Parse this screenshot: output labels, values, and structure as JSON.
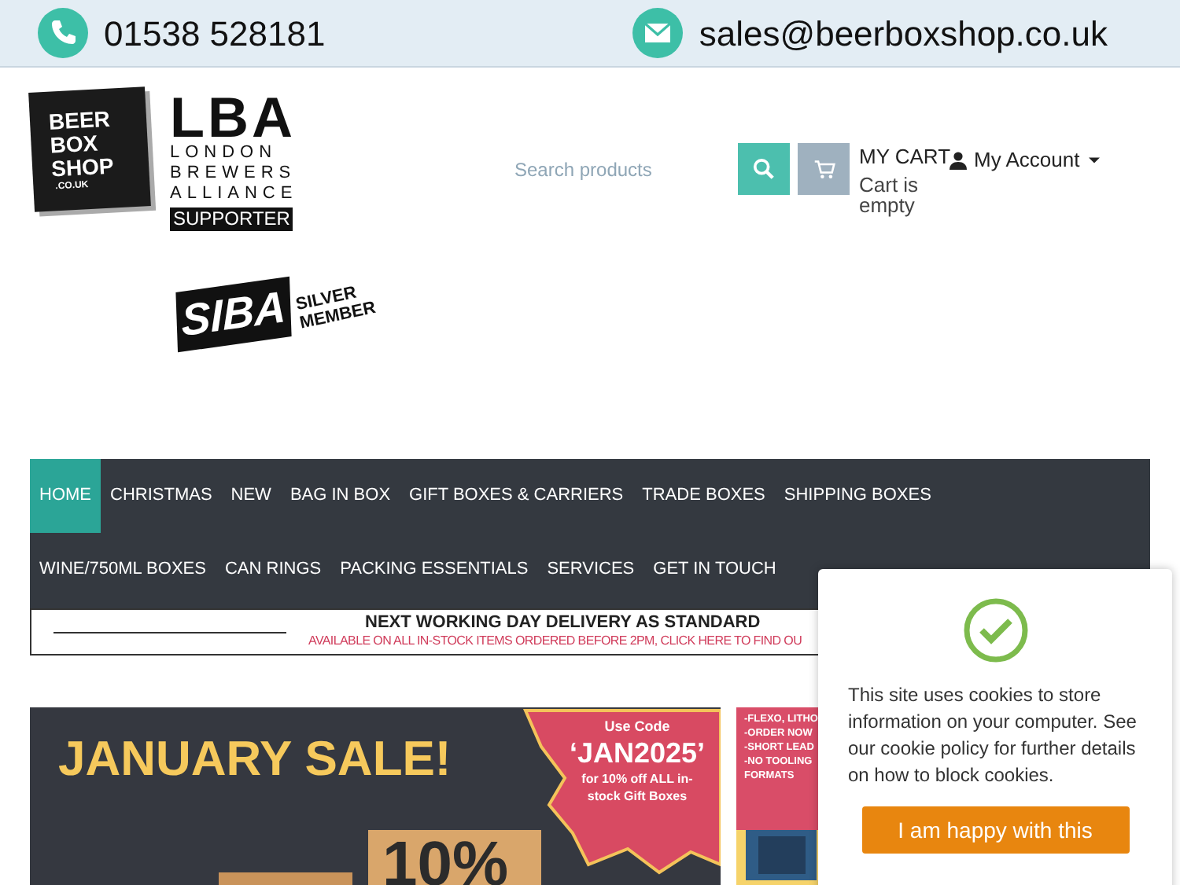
{
  "top_bar": {
    "phone": "01538 528181",
    "email": "sales@beerboxshop.co.uk"
  },
  "logos": {
    "beer_box_shop": [
      "BEER",
      "BOX",
      "SHOP",
      ".CO.UK"
    ],
    "lba": {
      "mark": "LBA",
      "lines": [
        "LONDON",
        "BREWERS",
        "ALLIANCE"
      ],
      "badge": "SUPPORTER"
    },
    "siba": {
      "mark": "SIBA",
      "lines": [
        "SILVER",
        "MEMBER"
      ]
    }
  },
  "search": {
    "placeholder": "Search products"
  },
  "cart": {
    "title": "MY CART",
    "status": "Cart is empty"
  },
  "account": {
    "label": "My Account"
  },
  "nav": [
    {
      "label": "HOME",
      "selected": true
    },
    {
      "label": "CHRISTMAS",
      "selected": false
    },
    {
      "label": "NEW",
      "selected": false
    },
    {
      "label": "BAG IN BOX",
      "selected": false
    },
    {
      "label": "GIFT BOXES & CARRIERS",
      "selected": false
    },
    {
      "label": "TRADE BOXES",
      "selected": false
    },
    {
      "label": "SHIPPING BOXES",
      "selected": false
    },
    {
      "label": "WINE/750ML BOXES",
      "selected": false
    },
    {
      "label": "CAN RINGS",
      "selected": false
    },
    {
      "label": "PACKING ESSENTIALS",
      "selected": false
    },
    {
      "label": "SERVICES",
      "selected": false
    },
    {
      "label": "GET IN TOUCH",
      "selected": false
    }
  ],
  "delivery": {
    "title": "NEXT WORKING DAY DELIVERY AS STANDARD",
    "subtitle": "AVAILABLE ON ALL IN-STOCK ITEMS ORDERED BEFORE 2PM, CLICK HERE TO FIND OU"
  },
  "banners": [
    {
      "kind": "sale",
      "title": "JANUARY SALE!",
      "code_label": "Use Code",
      "code": "‘JAN2025’",
      "offer": "for 10% off ALL in-stock Gift Boxes",
      "box_text": "10%"
    },
    {
      "kind": "print",
      "bullets": [
        "-FLEXO, LITHO",
        "-ORDER NOW",
        "-SHORT LEAD",
        "-NO TOOLING",
        "FORMATS"
      ]
    }
  ],
  "cookie": {
    "message": "This site uses cookies to store information on your computer. See our cookie policy for further details on how to block cookies.",
    "button": "I am happy with this"
  }
}
